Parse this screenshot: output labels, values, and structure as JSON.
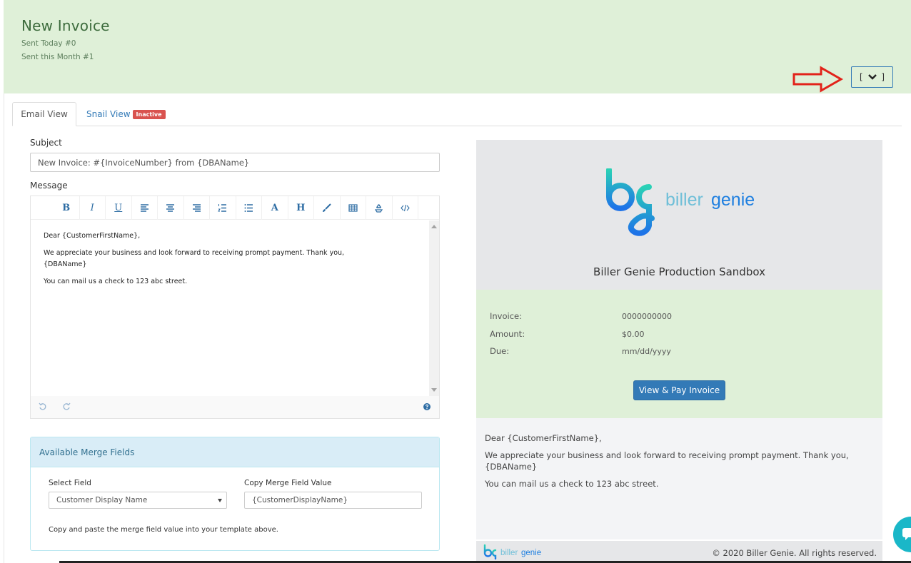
{
  "header": {
    "title": "New Invoice",
    "sent_today": "Sent Today #0",
    "sent_month": "Sent this Month #1",
    "toggle_left": "[",
    "toggle_right": "]",
    "toggle_icon": "chevron-down-icon",
    "annotation": "red-arrow-icon"
  },
  "tabs": {
    "email": "Email View",
    "snail": "Snail View",
    "snail_badge": "Inactive"
  },
  "form": {
    "subject_label": "Subject",
    "subject_value": "New Invoice: #{InvoiceNumber} from {DBAName}",
    "message_label": "Message",
    "toolbar": [
      "B",
      "I",
      "U",
      "align-left-icon",
      "align-center-icon",
      "align-right-icon",
      "ordered-list-icon",
      "unordered-list-icon",
      "A",
      "H",
      "brush-icon",
      "table-icon",
      "recycle-icon",
      "code-icon"
    ],
    "message_lines": {
      "greeting": "Dear {CustomerFirstName},",
      "line1": "We appreciate your business and look forward to receiving prompt payment. Thank you,",
      "line2": "{DBAName}",
      "line3": "You can mail us a check to 123 abc street."
    }
  },
  "merge": {
    "title": "Available Merge Fields",
    "select_label": "Select Field",
    "select_value": "Customer Display Name",
    "copy_label": "Copy Merge Field Value",
    "copy_value": "{CustomerDisplayName}",
    "note": "Copy and paste the merge field value into your template above."
  },
  "preview": {
    "brand_biller": "biller",
    "brand_genie": "genie",
    "company": "Biller Genie Production Sandbox",
    "invoice_label": "Invoice:",
    "invoice_value": "0000000000",
    "amount_label": "Amount:",
    "amount_value": "$0.00",
    "due_label": "Due:",
    "due_value": "mm/dd/yyyy",
    "pay_button": "View & Pay Invoice",
    "greeting": "Dear {CustomerFirstName},",
    "line1": "We appreciate your business and look forward to receiving prompt payment. Thank you,",
    "line2": "{DBAName}",
    "line3": "You can mail us a check to 123 abc street.",
    "copyright": "© 2020 Biller Genie. All rights reserved."
  },
  "colors": {
    "header_bg": "#dff0d8",
    "accent_blue": "#337ab7",
    "badge_red": "#d9534f",
    "brand_teal": "#1ab7c8"
  }
}
